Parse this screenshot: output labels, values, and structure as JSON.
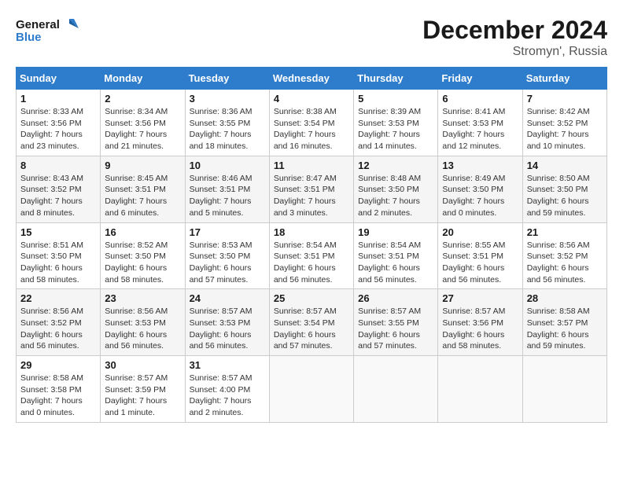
{
  "header": {
    "logo_line1": "General",
    "logo_line2": "Blue",
    "month": "December 2024",
    "location": "Stromyn', Russia"
  },
  "weekdays": [
    "Sunday",
    "Monday",
    "Tuesday",
    "Wednesday",
    "Thursday",
    "Friday",
    "Saturday"
  ],
  "weeks": [
    [
      {
        "day": 1,
        "lines": [
          "Sunrise: 8:33 AM",
          "Sunset: 3:56 PM",
          "Daylight: 7 hours",
          "and 23 minutes."
        ]
      },
      {
        "day": 2,
        "lines": [
          "Sunrise: 8:34 AM",
          "Sunset: 3:56 PM",
          "Daylight: 7 hours",
          "and 21 minutes."
        ]
      },
      {
        "day": 3,
        "lines": [
          "Sunrise: 8:36 AM",
          "Sunset: 3:55 PM",
          "Daylight: 7 hours",
          "and 18 minutes."
        ]
      },
      {
        "day": 4,
        "lines": [
          "Sunrise: 8:38 AM",
          "Sunset: 3:54 PM",
          "Daylight: 7 hours",
          "and 16 minutes."
        ]
      },
      {
        "day": 5,
        "lines": [
          "Sunrise: 8:39 AM",
          "Sunset: 3:53 PM",
          "Daylight: 7 hours",
          "and 14 minutes."
        ]
      },
      {
        "day": 6,
        "lines": [
          "Sunrise: 8:41 AM",
          "Sunset: 3:53 PM",
          "Daylight: 7 hours",
          "and 12 minutes."
        ]
      },
      {
        "day": 7,
        "lines": [
          "Sunrise: 8:42 AM",
          "Sunset: 3:52 PM",
          "Daylight: 7 hours",
          "and 10 minutes."
        ]
      }
    ],
    [
      {
        "day": 8,
        "lines": [
          "Sunrise: 8:43 AM",
          "Sunset: 3:52 PM",
          "Daylight: 7 hours",
          "and 8 minutes."
        ]
      },
      {
        "day": 9,
        "lines": [
          "Sunrise: 8:45 AM",
          "Sunset: 3:51 PM",
          "Daylight: 7 hours",
          "and 6 minutes."
        ]
      },
      {
        "day": 10,
        "lines": [
          "Sunrise: 8:46 AM",
          "Sunset: 3:51 PM",
          "Daylight: 7 hours",
          "and 5 minutes."
        ]
      },
      {
        "day": 11,
        "lines": [
          "Sunrise: 8:47 AM",
          "Sunset: 3:51 PM",
          "Daylight: 7 hours",
          "and 3 minutes."
        ]
      },
      {
        "day": 12,
        "lines": [
          "Sunrise: 8:48 AM",
          "Sunset: 3:50 PM",
          "Daylight: 7 hours",
          "and 2 minutes."
        ]
      },
      {
        "day": 13,
        "lines": [
          "Sunrise: 8:49 AM",
          "Sunset: 3:50 PM",
          "Daylight: 7 hours",
          "and 0 minutes."
        ]
      },
      {
        "day": 14,
        "lines": [
          "Sunrise: 8:50 AM",
          "Sunset: 3:50 PM",
          "Daylight: 6 hours",
          "and 59 minutes."
        ]
      }
    ],
    [
      {
        "day": 15,
        "lines": [
          "Sunrise: 8:51 AM",
          "Sunset: 3:50 PM",
          "Daylight: 6 hours",
          "and 58 minutes."
        ]
      },
      {
        "day": 16,
        "lines": [
          "Sunrise: 8:52 AM",
          "Sunset: 3:50 PM",
          "Daylight: 6 hours",
          "and 58 minutes."
        ]
      },
      {
        "day": 17,
        "lines": [
          "Sunrise: 8:53 AM",
          "Sunset: 3:50 PM",
          "Daylight: 6 hours",
          "and 57 minutes."
        ]
      },
      {
        "day": 18,
        "lines": [
          "Sunrise: 8:54 AM",
          "Sunset: 3:51 PM",
          "Daylight: 6 hours",
          "and 56 minutes."
        ]
      },
      {
        "day": 19,
        "lines": [
          "Sunrise: 8:54 AM",
          "Sunset: 3:51 PM",
          "Daylight: 6 hours",
          "and 56 minutes."
        ]
      },
      {
        "day": 20,
        "lines": [
          "Sunrise: 8:55 AM",
          "Sunset: 3:51 PM",
          "Daylight: 6 hours",
          "and 56 minutes."
        ]
      },
      {
        "day": 21,
        "lines": [
          "Sunrise: 8:56 AM",
          "Sunset: 3:52 PM",
          "Daylight: 6 hours",
          "and 56 minutes."
        ]
      }
    ],
    [
      {
        "day": 22,
        "lines": [
          "Sunrise: 8:56 AM",
          "Sunset: 3:52 PM",
          "Daylight: 6 hours",
          "and 56 minutes."
        ]
      },
      {
        "day": 23,
        "lines": [
          "Sunrise: 8:56 AM",
          "Sunset: 3:53 PM",
          "Daylight: 6 hours",
          "and 56 minutes."
        ]
      },
      {
        "day": 24,
        "lines": [
          "Sunrise: 8:57 AM",
          "Sunset: 3:53 PM",
          "Daylight: 6 hours",
          "and 56 minutes."
        ]
      },
      {
        "day": 25,
        "lines": [
          "Sunrise: 8:57 AM",
          "Sunset: 3:54 PM",
          "Daylight: 6 hours",
          "and 57 minutes."
        ]
      },
      {
        "day": 26,
        "lines": [
          "Sunrise: 8:57 AM",
          "Sunset: 3:55 PM",
          "Daylight: 6 hours",
          "and 57 minutes."
        ]
      },
      {
        "day": 27,
        "lines": [
          "Sunrise: 8:57 AM",
          "Sunset: 3:56 PM",
          "Daylight: 6 hours",
          "and 58 minutes."
        ]
      },
      {
        "day": 28,
        "lines": [
          "Sunrise: 8:58 AM",
          "Sunset: 3:57 PM",
          "Daylight: 6 hours",
          "and 59 minutes."
        ]
      }
    ],
    [
      {
        "day": 29,
        "lines": [
          "Sunrise: 8:58 AM",
          "Sunset: 3:58 PM",
          "Daylight: 7 hours",
          "and 0 minutes."
        ]
      },
      {
        "day": 30,
        "lines": [
          "Sunrise: 8:57 AM",
          "Sunset: 3:59 PM",
          "Daylight: 7 hours",
          "and 1 minute."
        ]
      },
      {
        "day": 31,
        "lines": [
          "Sunrise: 8:57 AM",
          "Sunset: 4:00 PM",
          "Daylight: 7 hours",
          "and 2 minutes."
        ]
      },
      null,
      null,
      null,
      null
    ]
  ]
}
